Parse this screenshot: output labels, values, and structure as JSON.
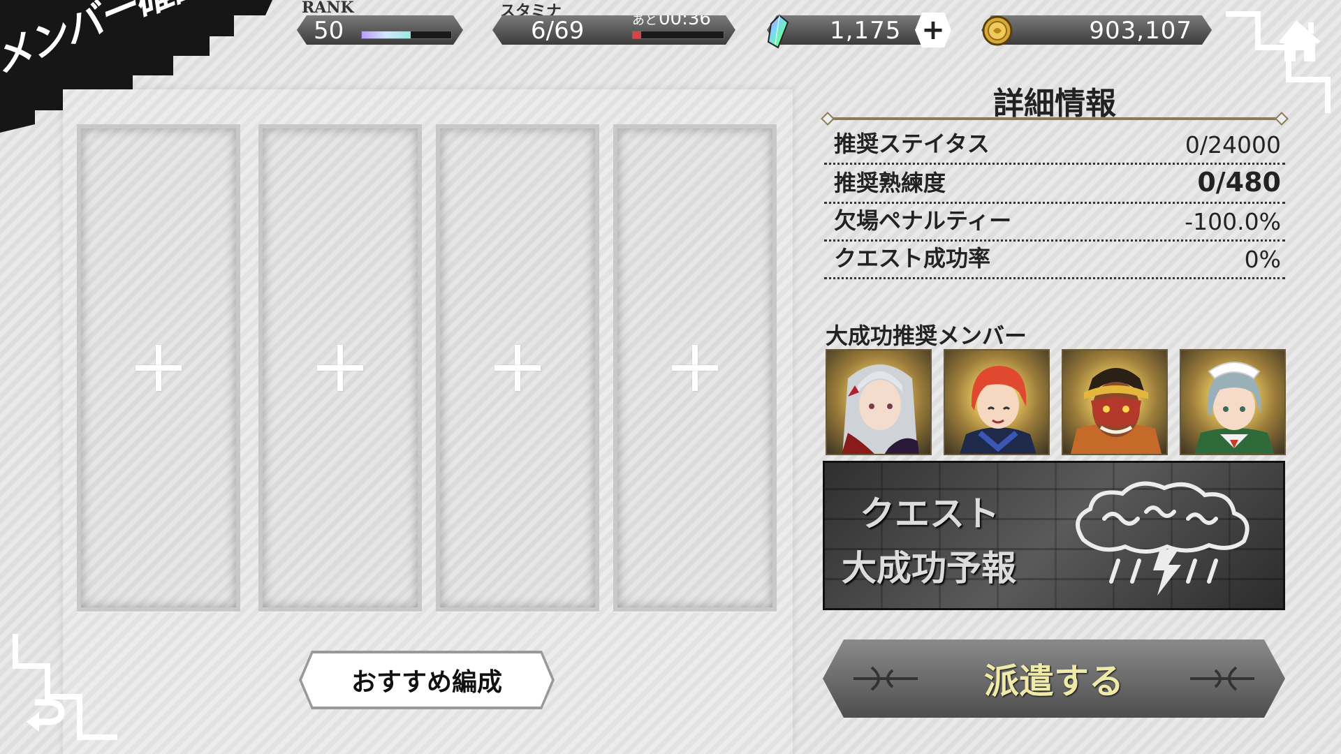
{
  "header": {
    "title": "メンバー確認",
    "rank": {
      "label": "RANK",
      "value": "50",
      "progress": 0.55
    },
    "stamina": {
      "label": "スタミナ",
      "value": "6/69",
      "timer_prefix": "あと",
      "timer": "00:36",
      "progress": 0.09
    },
    "gems": {
      "value": "1,175",
      "add_label": "+"
    },
    "coins": {
      "value": "903,107"
    }
  },
  "party": {
    "slots": [
      {
        "label": "+"
      },
      {
        "label": "+"
      },
      {
        "label": "+"
      },
      {
        "label": "+"
      }
    ],
    "recommend_label": "おすすめ編成"
  },
  "details": {
    "title": "詳細情報",
    "stats": [
      {
        "label": "推奨ステイタス",
        "value": "0/24000"
      },
      {
        "label": "推奨熟練度",
        "value": "0/480"
      },
      {
        "label": "欠場ペナルティー",
        "value": "-100.0%"
      },
      {
        "label": "クエスト成功率",
        "value": "0%"
      }
    ],
    "members_label": "大成功推奨メンバー",
    "forecast": {
      "line1": "クエスト",
      "line2": "大成功予報"
    },
    "dispatch_label": "派遣する"
  },
  "colors": {
    "accent_gold": "#8a7a58",
    "dispatch_text": "#f0eaa8",
    "stamina_fill": "#d84444"
  },
  "icons": [
    "gem-icon",
    "coin-icon",
    "home-icon",
    "back-arrow-icon",
    "storm-cloud-icon"
  ]
}
